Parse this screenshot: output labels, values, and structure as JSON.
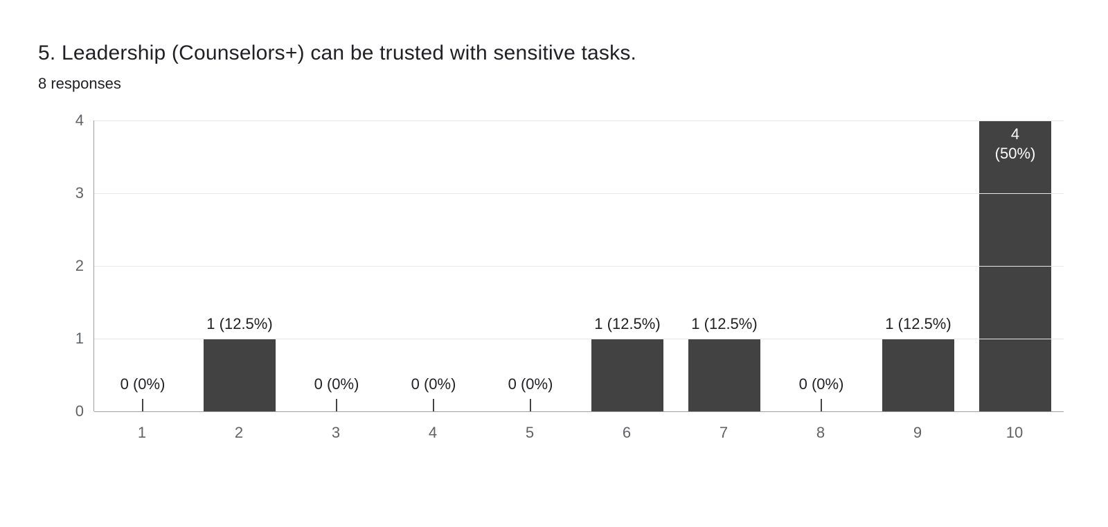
{
  "title": "5. Leadership (Counselors+) can be trusted with sensitive tasks.",
  "subtitle": "8 responses",
  "chart_data": {
    "type": "bar",
    "categories": [
      "1",
      "2",
      "3",
      "4",
      "5",
      "6",
      "7",
      "8",
      "9",
      "10"
    ],
    "values": [
      0,
      1,
      0,
      0,
      0,
      1,
      1,
      0,
      1,
      4
    ],
    "percents": [
      "0%",
      "12.5%",
      "0%",
      "0%",
      "0%",
      "12.5%",
      "12.5%",
      "0%",
      "12.5%",
      "50%"
    ],
    "labels": [
      "0 (0%)",
      "1 (12.5%)",
      "0 (0%)",
      "0 (0%)",
      "0 (0%)",
      "1 (12.5%)",
      "1 (12.5%)",
      "0 (0%)",
      "1 (12.5%)",
      "4\n(50%)"
    ],
    "yticks": [
      0,
      1,
      2,
      3,
      4
    ],
    "ylim": [
      0,
      4
    ],
    "title": "5. Leadership (Counselors+) can be trusted with sensitive tasks.",
    "xlabel": "",
    "ylabel": "",
    "bar_color": "#424242"
  }
}
